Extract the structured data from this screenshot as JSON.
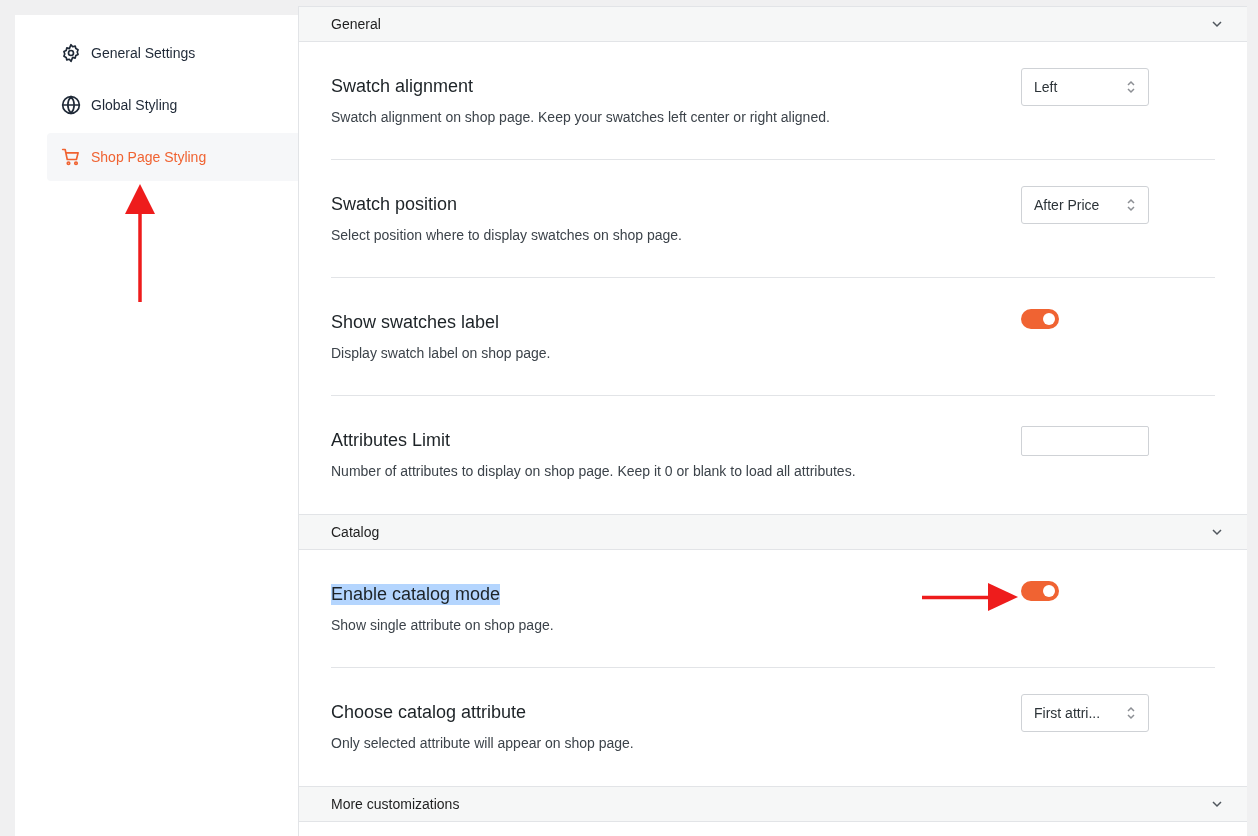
{
  "sidebar": {
    "items": [
      {
        "kind": "gear",
        "label": "General Settings",
        "selected": false
      },
      {
        "kind": "globe",
        "label": "Global Styling",
        "selected": false
      },
      {
        "kind": "cart",
        "label": "Shop Page Styling",
        "selected": true
      }
    ]
  },
  "sections": [
    {
      "title": "General",
      "rows": [
        {
          "kind": "select",
          "title": "Swatch alignment",
          "description": "Swatch alignment on shop page. Keep your swatches left center or right aligned.",
          "value": "Left"
        },
        {
          "kind": "select",
          "title": "Swatch position",
          "description": "Select position where to display swatches on shop page.",
          "value": "After Price"
        },
        {
          "kind": "toggle",
          "title": "Show swatches label",
          "description": "Display swatch label on shop page.",
          "on": true
        },
        {
          "kind": "number",
          "title": "Attributes Limit",
          "description": "Number of attributes to display on shop page. Keep it 0 or blank to load all attributes."
        }
      ]
    },
    {
      "title": "Catalog",
      "rows": [
        {
          "kind": "toggle",
          "title": "Enable catalog mode",
          "description": "Show single attribute on shop page.",
          "on": true,
          "highlighted": true
        },
        {
          "kind": "select",
          "title": "Choose catalog attribute",
          "description": "Only selected attribute will appear on shop page.",
          "value": "First attri..."
        }
      ]
    },
    {
      "title": "More customizations"
    }
  ]
}
